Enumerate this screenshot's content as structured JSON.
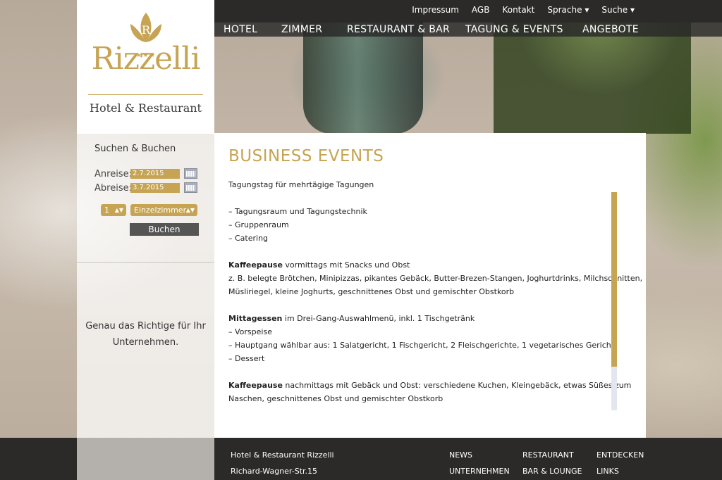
{
  "top_links": [
    "Impressum",
    "AGB",
    "Kontakt",
    "Sprache ▾",
    "Suche ▾"
  ],
  "nav": [
    "HOTEL",
    "ZIMMER",
    "RESTAURANT & BAR",
    "TAGUNG & EVENTS",
    "ANGEBOTE"
  ],
  "logo": {
    "name": "Rizzelli",
    "subtitle": "Hotel & Restaurant",
    "letter": "R",
    "stars": "★ ★ ★"
  },
  "booking": {
    "title": "Suchen & Buchen",
    "arrival_label": "Anreise:",
    "arrival_value": "2.7.2015",
    "departure_label": "Abreise:",
    "departure_value": "3.7.2015",
    "rooms_count": "1",
    "room_type": "Einzelzimmer",
    "submit": "Buchen"
  },
  "tagline": "Genau das Richtige für Ihr Unternehmen.",
  "content": {
    "title": "BUSINESS EVENTS",
    "intro": "Tagungstag für mehrtägige Tagungen",
    "list": [
      "– Tagungsraum und Tagungstechnik",
      "– Gruppenraum",
      "– Catering"
    ],
    "coffee1_bold": "Kaffeepause",
    "coffee1_rest": " vormittags mit Snacks und Obst",
    "coffee1_l2": "z. B. belegte Brötchen, Minipizzas, pikantes Gebäck, Butter-Brezen-Stangen, Joghurtdrinks, Milchschnitten,",
    "coffee1_l3": "Müsliriegel, kleine Joghurts, geschnittenes Obst und gemischter Obstkorb",
    "lunch_bold": "Mittagessen",
    "lunch_rest": " im Drei-Gang-Auswahlmenü, inkl. 1 Tischgetränk",
    "lunch_items": [
      "– Vorspeise",
      "– Hauptgang wählbar aus: 1 Salatgericht, 1 Fischgericht, 2 Fleischgerichte, 1 vegetarisches Gericht",
      "– Dessert"
    ],
    "coffee2_bold": "Kaffeepause",
    "coffee2_rest": " nachmittags mit Gebäck und Obst: verschiedene Kuchen, Kleingebäck, etwas Süßes zum",
    "coffee2_l2": "Naschen, geschnittenes Obst und gemischter Obstkorb"
  },
  "footer": {
    "address1": "Hotel & Restaurant Rizzelli",
    "address2": "Richard-Wagner-Str.15",
    "col1": [
      "NEWS",
      "UNTERNEHMEN"
    ],
    "col2": [
      "RESTAURANT",
      "BAR & LOUNGE"
    ],
    "col3": [
      "ENTDECKEN",
      "LINKS"
    ]
  },
  "colors": {
    "accent": "#c6a453",
    "dark": "#2b2a28"
  }
}
